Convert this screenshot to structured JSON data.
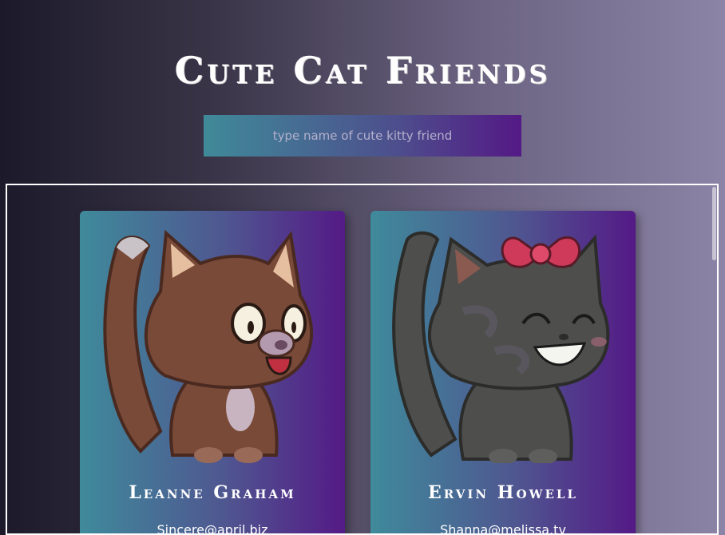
{
  "header": {
    "title": "Cute Cat Friends"
  },
  "search": {
    "placeholder": "type name of cute kitty friend",
    "value": ""
  },
  "cards": [
    {
      "name": "Leanne Graham",
      "email": "Sincere@april.biz",
      "avatar_icon": "brown-cat-icon"
    },
    {
      "name": "Ervin Howell",
      "email": "Shanna@melissa.tv",
      "avatar_icon": "gray-cat-bow-icon"
    }
  ],
  "colors": {
    "card_gradient_start": "#3f8a9b",
    "card_gradient_end": "#541a86",
    "brown_cat": "#7a4a38",
    "gray_cat": "#4e4e4c",
    "bow": "#d03a5a"
  }
}
